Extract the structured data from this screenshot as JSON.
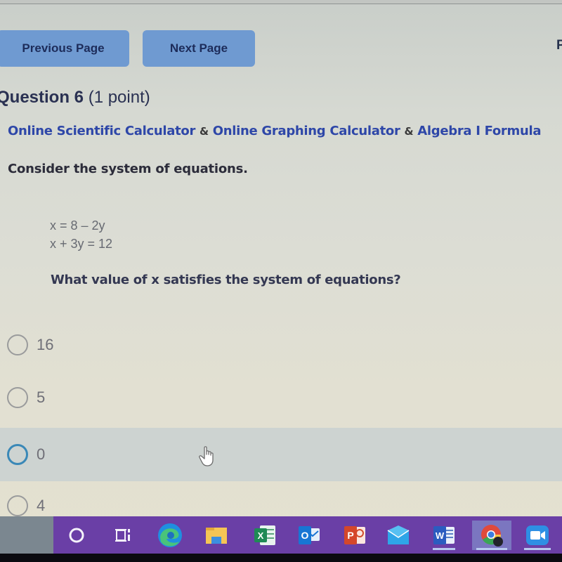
{
  "navigation": {
    "previous_label": "Previous Page",
    "next_label": "Next Page",
    "edge_partial_text": "P"
  },
  "question": {
    "number_label": "Question 6",
    "points_label": "(1 point)",
    "resources": [
      {
        "label": "Online Scientific Calculator"
      },
      {
        "label": "Online Graphing Calculator"
      },
      {
        "label": "Algebra I Formula"
      }
    ],
    "separator": "&",
    "intro": "Consider the system of equations.",
    "equations": [
      "x = 8 – 2y",
      "x + 3y = 12"
    ],
    "prompt": "What value of x satisfies the system of equations?",
    "options": [
      {
        "label": "16",
        "selected": false,
        "focused": false
      },
      {
        "label": "5",
        "selected": false,
        "focused": false
      },
      {
        "label": "0",
        "selected": false,
        "focused": true,
        "hovered": true
      },
      {
        "label": "4",
        "selected": false,
        "focused": false
      }
    ]
  },
  "taskbar": {
    "icons": [
      {
        "name": "search-icon"
      },
      {
        "name": "task-view-icon"
      },
      {
        "name": "edge-icon"
      },
      {
        "name": "file-explorer-icon"
      },
      {
        "name": "excel-icon",
        "letter": "X"
      },
      {
        "name": "outlook-icon",
        "letter": "O"
      },
      {
        "name": "powerpoint-icon",
        "letter": "P"
      },
      {
        "name": "mail-icon"
      },
      {
        "name": "word-icon",
        "letter": "W"
      },
      {
        "name": "chrome-icon",
        "active": true
      },
      {
        "name": "zoom-icon"
      }
    ]
  },
  "colors": {
    "nav_button": "#6f9ad1",
    "link": "#2e47a8",
    "focus_ring": "#3a88b7",
    "taskbar": "#6a3fa6",
    "hover_row": "#cdd3d1"
  }
}
